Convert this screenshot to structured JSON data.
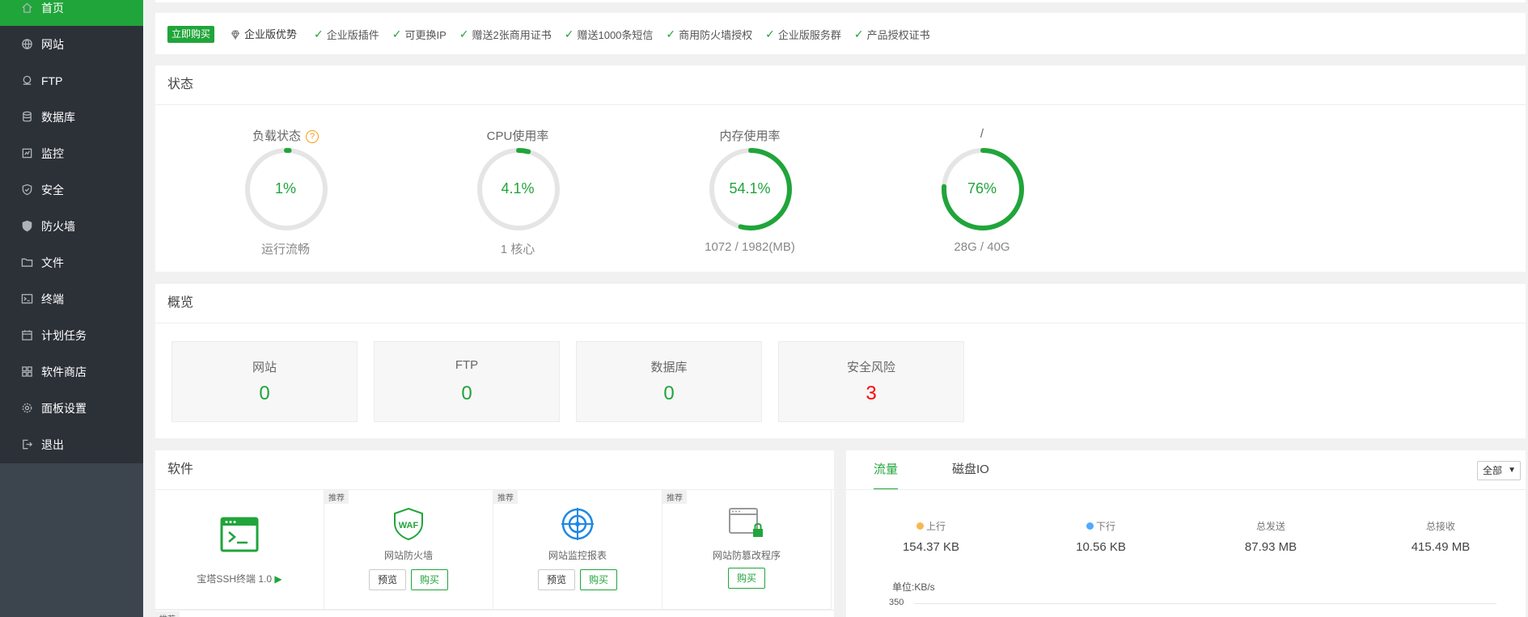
{
  "sidebar": {
    "items": [
      {
        "label": "首页",
        "icon": "home-icon",
        "active": true
      },
      {
        "label": "网站",
        "icon": "globe-icon"
      },
      {
        "label": "FTP",
        "icon": "ftp-icon"
      },
      {
        "label": "数据库",
        "icon": "database-icon"
      },
      {
        "label": "监控",
        "icon": "monitor-icon"
      },
      {
        "label": "安全",
        "icon": "shield-icon"
      },
      {
        "label": "防火墙",
        "icon": "firewall-icon"
      },
      {
        "label": "文件",
        "icon": "folder-icon"
      },
      {
        "label": "终端",
        "icon": "terminal-icon"
      },
      {
        "label": "计划任务",
        "icon": "calendar-icon"
      },
      {
        "label": "软件商店",
        "icon": "grid-icon"
      },
      {
        "label": "面板设置",
        "icon": "gear-icon"
      },
      {
        "label": "退出",
        "icon": "logout-icon"
      }
    ]
  },
  "banner": {
    "buy_label": "立即购买",
    "title": "企业版优势",
    "features": [
      "企业版插件",
      "可更换IP",
      "赠送2张商用证书",
      "赠送1000条短信",
      "商用防火墙授权",
      "企业版服务群",
      "产品授权证书"
    ]
  },
  "status": {
    "title": "状态",
    "gauges": [
      {
        "title": "负载状态",
        "value_text": "1%",
        "percent": 1,
        "sub": "运行流畅",
        "help": "?"
      },
      {
        "title": "CPU使用率",
        "value_text": "4.1%",
        "percent": 4.1,
        "sub": "1 核心"
      },
      {
        "title": "内存使用率",
        "value_text": "54.1%",
        "percent": 54.1,
        "sub": "1072 / 1982(MB)"
      },
      {
        "title": "/",
        "value_text": "76%",
        "percent": 76,
        "sub": "28G / 40G"
      }
    ]
  },
  "overview": {
    "title": "概览",
    "cards": [
      {
        "label": "网站",
        "value": "0"
      },
      {
        "label": "FTP",
        "value": "0"
      },
      {
        "label": "数据库",
        "value": "0"
      },
      {
        "label": "安全风险",
        "value": "3"
      }
    ]
  },
  "software": {
    "title": "软件",
    "recommend_badge": "推荐",
    "items": [
      {
        "name": "宝塔SSH终端 1.0",
        "arrow": "▶"
      },
      {
        "name": "网站防火墙",
        "preview": "预览",
        "buy": "购买",
        "icon_text": "WAF"
      },
      {
        "name": "网站监控报表",
        "preview": "预览",
        "buy": "购买"
      },
      {
        "name": "网站防篡改程序",
        "buy": "购买"
      }
    ]
  },
  "traffic": {
    "tabs": [
      "流量",
      "磁盘IO"
    ],
    "select_value": "全部",
    "stats": [
      {
        "label": "上行",
        "value": "154.37 KB",
        "dot_color": "#f7b851"
      },
      {
        "label": "下行",
        "value": "10.56 KB",
        "dot_color": "#52a9ff"
      },
      {
        "label": "总发送",
        "value": "87.93 MB"
      },
      {
        "label": "总接收",
        "value": "415.49 MB"
      }
    ],
    "unit_label": "单位:KB/s",
    "axis_tick": "350"
  },
  "colors": {
    "accent": "#20a53a",
    "danger": "#ff0000",
    "sidebar_bg": "#2c3138"
  }
}
